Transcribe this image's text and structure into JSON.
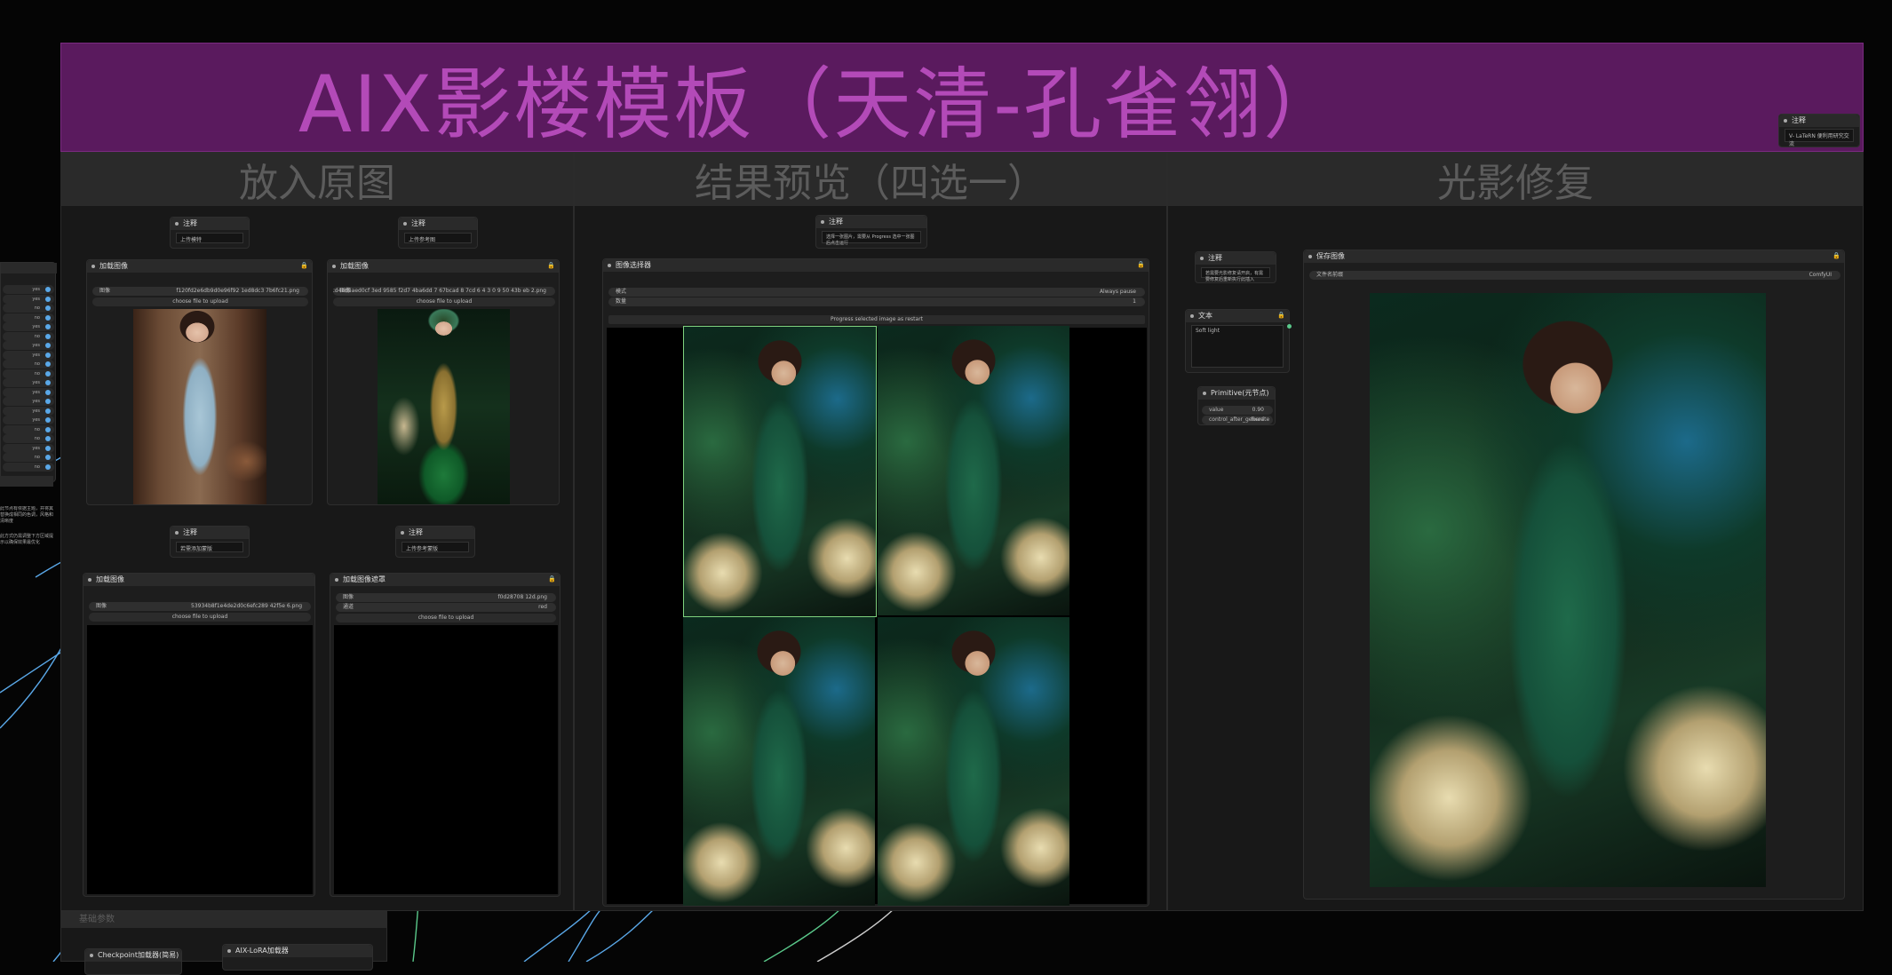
{
  "banner": {
    "title": "AIX影楼模板（天清-孔雀翎）"
  },
  "groups": {
    "input": {
      "title": "放入原图"
    },
    "preview": {
      "title": "结果预览（四选一）"
    },
    "relight": {
      "title": "光影修复"
    },
    "params": {
      "title": "基础参数"
    }
  },
  "nodes": {
    "note_a": {
      "title": "注释",
      "text": "上传模特"
    },
    "note_b": {
      "title": "注释",
      "text": "上传参考图"
    },
    "load_a": {
      "title": "加载图像",
      "field": "图像",
      "file": "f120fd2e6db9d0e96f92 1ed8dc3 7b6fc21.png",
      "upload": "choose file to upload"
    },
    "load_b": {
      "title": "加载图像",
      "field": "图像",
      "file": "d1f2e4fcd4ed5aed0cf 3ed 9585 f2d7 4ba6dd 7 67bcad 8 7cd 6 4 3 0 9 50 43b eb 2.png",
      "upload": "choose file to upload"
    },
    "note_c": {
      "title": "注释",
      "text": "若需添加蒙版"
    },
    "note_d": {
      "title": "注释",
      "text": "上传参考蒙版"
    },
    "load_c": {
      "title": "加载图像",
      "field": "图像",
      "file": "53934b8f1e4de2d0c6efc289 42f5e 6.png",
      "upload": "choose file to upload"
    },
    "load_d": {
      "title": "加载图像遮罩",
      "field": "图像",
      "file": "f0d28708 12d.png",
      "field2": "通道",
      "value2": "red",
      "upload": "choose file to upload"
    },
    "note_preview": {
      "title": "注释",
      "text": "选择一张图片，需要从 Progress 选中一张图后点击运行"
    },
    "selector": {
      "title": "图像选择器",
      "mode_label": "模式",
      "mode_value": "Always pause",
      "count_label": "数量",
      "count_value": "1",
      "button": "Progress selected image as restart"
    },
    "note_relight": {
      "title": "注释",
      "text": "若需要光影修复请开启，有需要修复后重新执行此插入"
    },
    "text_node": {
      "title": "文本",
      "text": "Soft light"
    },
    "primitive": {
      "title": "Primitive(元节点)",
      "value_label": "value",
      "value": "0.90",
      "control_label": "control_after_generate",
      "control_value": "fixed"
    },
    "save_node": {
      "title": "保存图像",
      "field": "文件名前缀",
      "value": "ComfyUI"
    },
    "corner_note": {
      "title": "注释",
      "text": "V- LaTeRN 便利用研究交流"
    },
    "checkpoint": {
      "title": "Checkpoint加载器(简易)"
    },
    "lora": {
      "title": "AIX-LoRA加载器"
    }
  },
  "sidebar": {
    "rows": [
      "yes",
      "yes",
      "no",
      "no",
      "yes",
      "no",
      "yes",
      "yes",
      "no",
      "no",
      "yes",
      "yes",
      "yes",
      "yes",
      "yes",
      "no",
      "no",
      "yes",
      "no",
      "no"
    ],
    "paragraphs": [
      "此节点有依据主题，并将其替换成相同的色调，风格和清晰度",
      "此方式仍需调整下方区域提示以确保效果最优化"
    ]
  },
  "colors": {
    "banner_bg": "#5a1a5e",
    "banner_text": "#b34ab8",
    "wire_blue": "#5aa8e8",
    "wire_green": "#5ac88a",
    "wire_white": "#cccccc"
  }
}
